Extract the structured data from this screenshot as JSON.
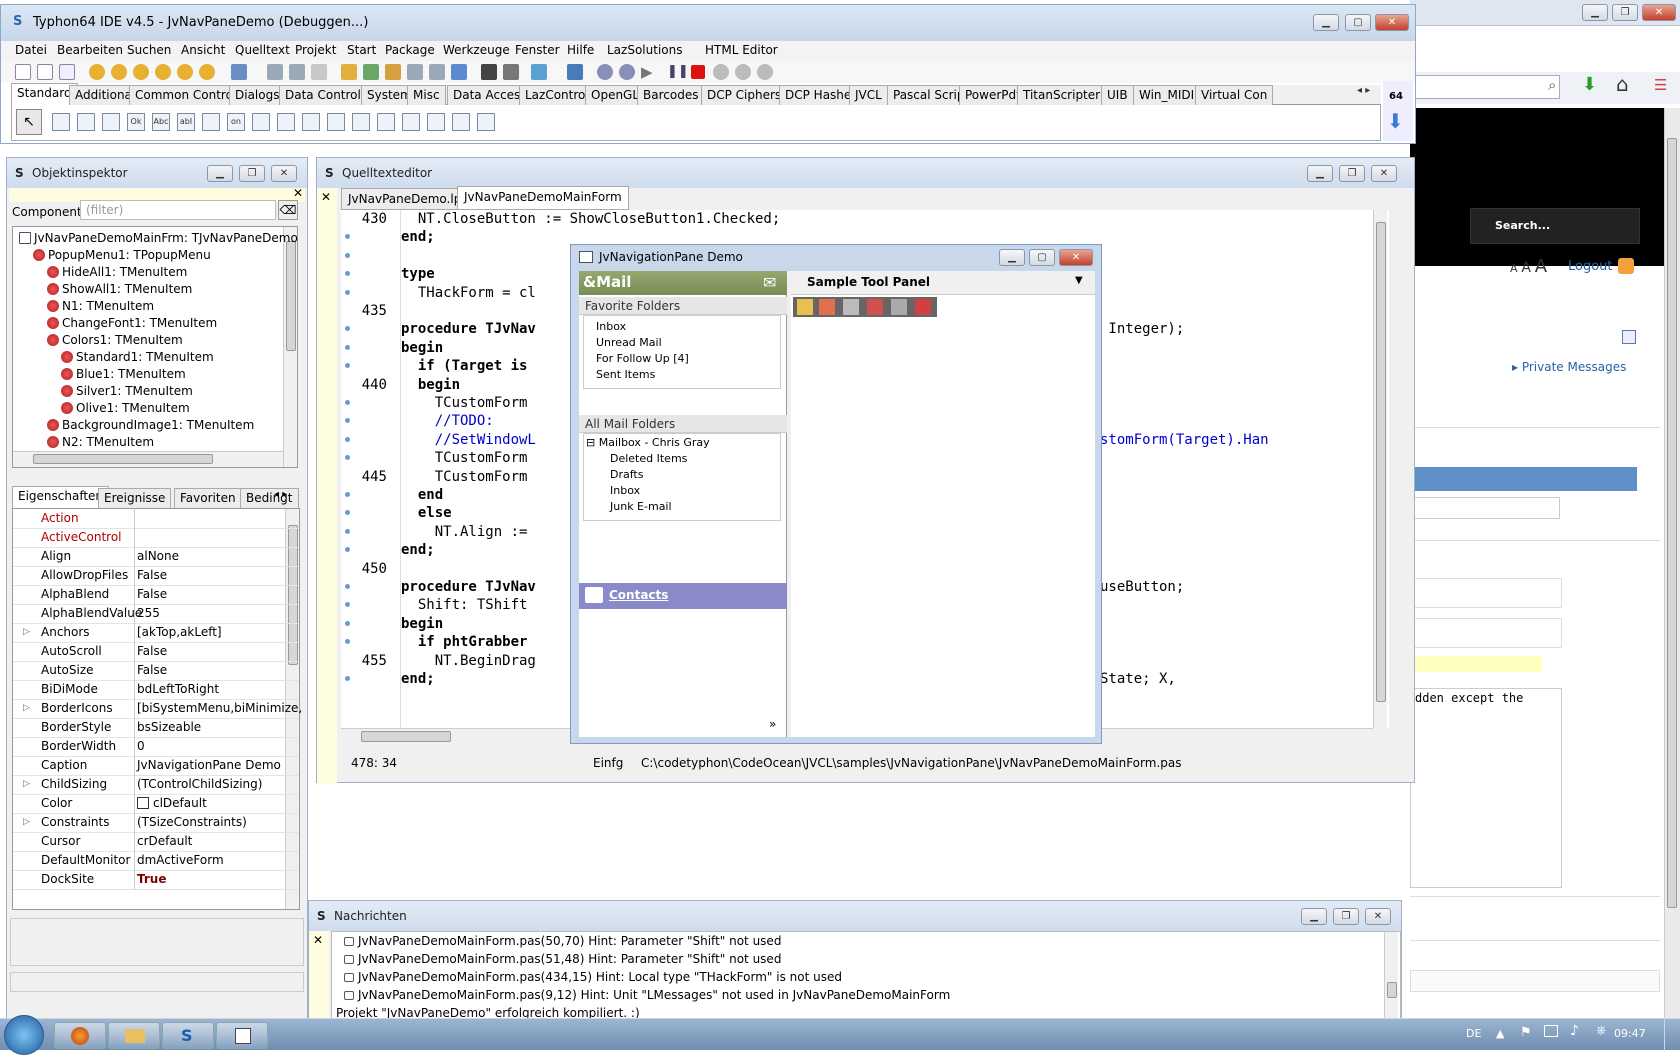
{
  "ide": {
    "title": "Typhon64 IDE v4.5 - JvNavPaneDemo (Debuggen...)",
    "menu": [
      "Datei",
      "Bearbeiten",
      "Suchen",
      "Ansicht",
      "Quelltext",
      "Projekt",
      "Start",
      "Package",
      "Werkzeuge",
      "Fenster",
      "Hilfe",
      "LazSolutions",
      "HTML Editor"
    ],
    "palette_tabs": [
      "Standard",
      "Additional",
      "Common Controls",
      "Dialogs",
      "Data Controls",
      "System",
      "Misc",
      "Data Access",
      "LazControls",
      "OpenGL",
      "Barcodes",
      "DCP Ciphers",
      "DCP Hashes",
      "JVCL",
      "Pascal Script",
      "PowerPdf",
      "TitanScripter",
      "UIB",
      "Win_MIDI",
      "Virtual Con"
    ],
    "badge_64": "64",
    "palette_icons": [
      "",
      "",
      "",
      "Ok",
      "Abc",
      "abI",
      "",
      "on",
      "",
      "",
      "",
      "",
      "",
      "",
      "",
      "",
      "",
      ""
    ]
  },
  "inspector": {
    "title": "Objektinspektor",
    "components_label": "Components",
    "filter_placeholder": "(filter)",
    "tree": [
      {
        "text": "JvNavPaneDemoMainFrm: TJvNavPaneDemo",
        "indent": 0
      },
      {
        "text": "PopupMenu1: TPopupMenu",
        "indent": 1
      },
      {
        "text": "HideAll1: TMenuItem",
        "indent": 2
      },
      {
        "text": "ShowAll1: TMenuItem",
        "indent": 2
      },
      {
        "text": "N1: TMenuItem",
        "indent": 2
      },
      {
        "text": "ChangeFont1: TMenuItem",
        "indent": 2
      },
      {
        "text": "Colors1: TMenuItem",
        "indent": 2
      },
      {
        "text": "Standard1: TMenuItem",
        "indent": 3
      },
      {
        "text": "Blue1: TMenuItem",
        "indent": 3
      },
      {
        "text": "Silver1: TMenuItem",
        "indent": 3
      },
      {
        "text": "Olive1: TMenuItem",
        "indent": 3
      },
      {
        "text": "BackgroundImage1: TMenuItem",
        "indent": 2
      },
      {
        "text": "N2: TMenuItem",
        "indent": 2
      }
    ],
    "tabs": [
      "Eigenschaften",
      "Ereignisse",
      "Favoriten",
      "Bedingt"
    ],
    "properties": [
      {
        "name": "Action",
        "value": "",
        "red": true
      },
      {
        "name": "ActiveControl",
        "value": "",
        "red": true
      },
      {
        "name": "Align",
        "value": "alNone"
      },
      {
        "name": "AllowDropFiles",
        "value": "False"
      },
      {
        "name": "AlphaBlend",
        "value": "False"
      },
      {
        "name": "AlphaBlendValue",
        "value": "255"
      },
      {
        "name": "Anchors",
        "value": "[akTop,akLeft]",
        "expand": true
      },
      {
        "name": "AutoScroll",
        "value": "False"
      },
      {
        "name": "AutoSize",
        "value": "False"
      },
      {
        "name": "BiDiMode",
        "value": "bdLeftToRight"
      },
      {
        "name": "BorderIcons",
        "value": "[biSystemMenu,biMinimize,",
        "expand": true
      },
      {
        "name": "BorderStyle",
        "value": "bsSizeable"
      },
      {
        "name": "BorderWidth",
        "value": "0"
      },
      {
        "name": "Caption",
        "value": "JvNavigationPane Demo"
      },
      {
        "name": "ChildSizing",
        "value": "(TControlChildSizing)",
        "expand": true
      },
      {
        "name": "Color",
        "value": "clDefault"
      },
      {
        "name": "Constraints",
        "value": "(TSizeConstraints)",
        "expand": true
      },
      {
        "name": "Cursor",
        "value": "crDefault"
      },
      {
        "name": "DefaultMonitor",
        "value": "dmActiveForm"
      },
      {
        "name": "DockSite",
        "value": "True",
        "bold": true
      }
    ]
  },
  "editor": {
    "title": "Quelltexteditor",
    "tabs": [
      "JvNavPaneDemo.lpr",
      "JvNavPaneDemoMainForm"
    ],
    "status_pos": "478: 34",
    "status_mode": "Einfg",
    "status_file": "C:\\codetyphon\\CodeOcean\\JVCL\\samples\\JvNavigationPane\\JvNavPaneDemoMainForm.pas",
    "line_numbers": [
      "430",
      "",
      "",
      "",
      "",
      "435",
      "",
      "",
      "",
      "440",
      "",
      "",
      "",
      "",
      "445",
      "",
      "",
      "",
      "",
      "450",
      "",
      "",
      "",
      "",
      "455",
      ""
    ],
    "right_fragments": {
      "l435": "; X, Y: Integer);",
      "l440": "ong(TCustomForm(Target).Han",
      "l450": "on: TMouseButton;",
      "l456": "IdShiftState; X,"
    },
    "lines": [
      "  NT.CloseButton := ShowCloseButton1.Checked;",
      "end;",
      "",
      "type",
      "  THackForm = cl",
      "",
      "procedure TJvNav",
      "begin",
      "  if (Target is",
      "  begin",
      "    TCustomForm",
      "    //TODO:",
      "    //SetWindowL",
      "    TCustomForm",
      "    TCustomForm",
      "  end",
      "  else",
      "    NT.Align :=",
      "end;",
      "",
      "procedure TJvNav",
      "  Shift: TShift",
      "begin",
      "  if phtGrabber",
      "    NT.BeginDrag",
      "end;"
    ]
  },
  "demo": {
    "title": "JvNavigationPane Demo",
    "mail_header": "&Mail",
    "favorite_folders": "Favorite Folders",
    "favorites": [
      "Inbox",
      "Unread Mail",
      "For Follow Up [4]",
      "Sent Items"
    ],
    "all_folders": "All Mail Folders",
    "mailbox": "Mailbox - Chris Gray",
    "folders": [
      "Deleted Items",
      "Drafts",
      "Inbox",
      "Junk E-mail"
    ],
    "contacts": "Contacts",
    "tool_panel": "Sample Tool Panel"
  },
  "messages": {
    "title": "Nachrichten",
    "lines": [
      "JvNavPaneDemoMainForm.pas(50,70) Hint: Parameter \"Shift\" not used",
      "JvNavPaneDemoMainForm.pas(51,48) Hint: Parameter \"Shift\" not used",
      "JvNavPaneDemoMainForm.pas(434,15) Hint: Local type \"THackForm\" is not used",
      "JvNavPaneDemoMainForm.pas(9,12) Hint: Unit \"LMessages\" not used in JvNavPaneDemoMainForm"
    ],
    "result": "Projekt \"JvNavPaneDemo\" erfolgreich kompiliert. :)"
  },
  "browser": {
    "search": "Search...",
    "font_sizes": [
      "A",
      "A",
      "A"
    ],
    "logout": "Logout",
    "private_messages": "Private Messages",
    "code_fragment": "dden except the"
  },
  "taskbar": {
    "lang": "DE",
    "time": "09:47"
  }
}
